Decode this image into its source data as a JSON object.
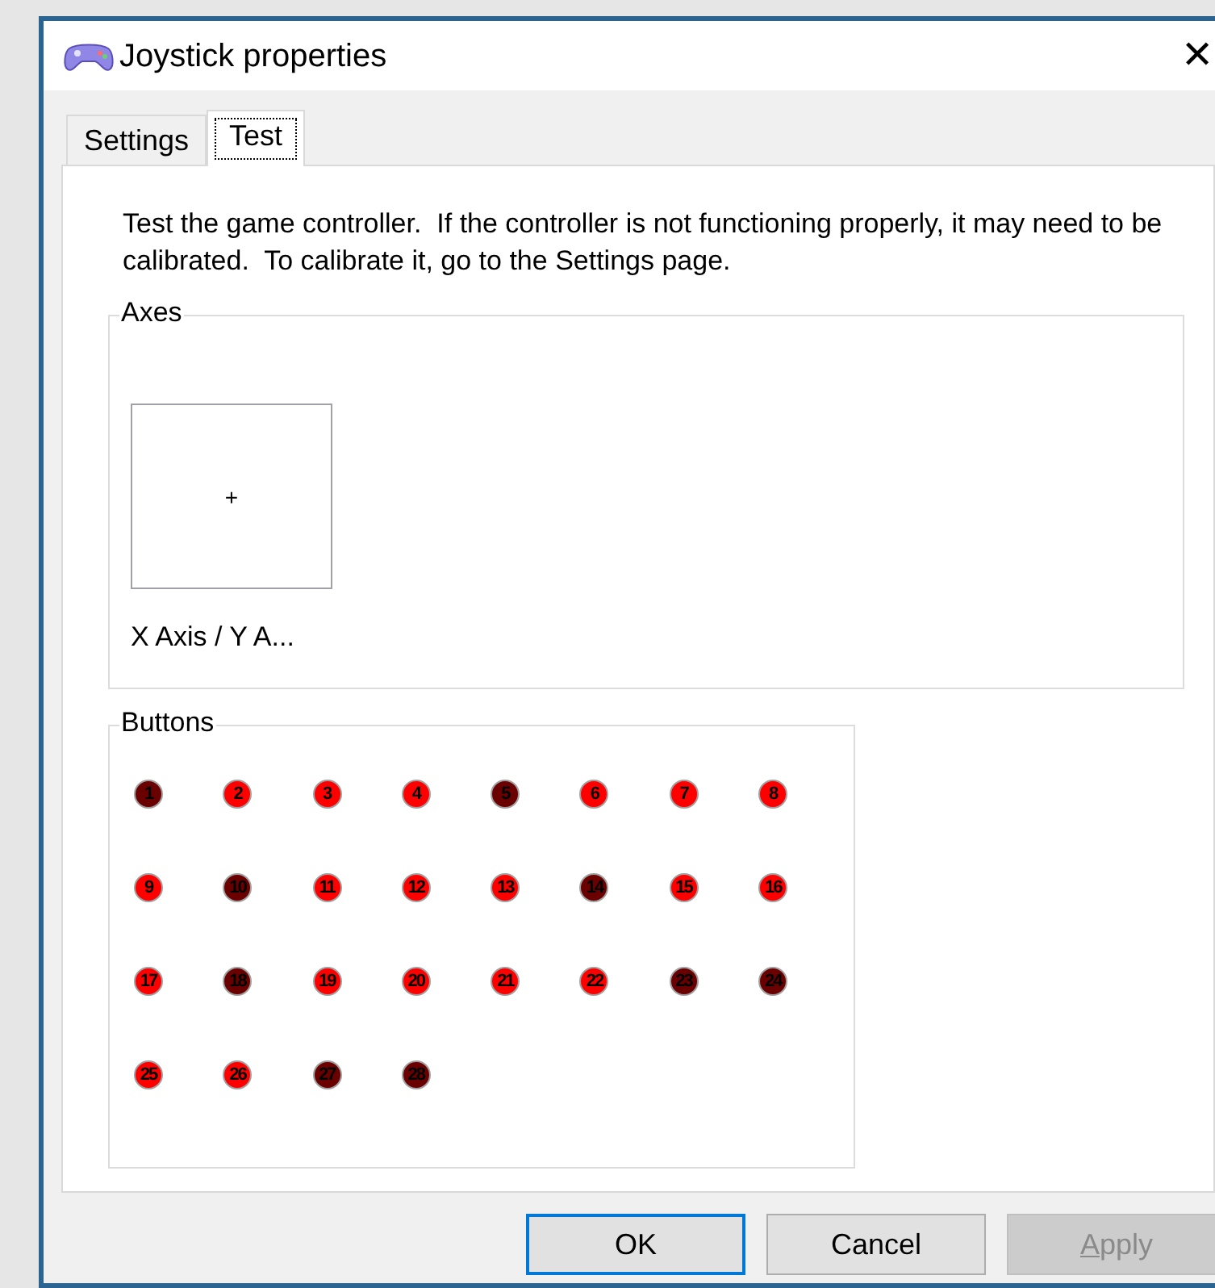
{
  "window": {
    "title": "Joystick properties",
    "close": "✕"
  },
  "tabs": [
    {
      "label": "Settings",
      "selected": false
    },
    {
      "label": "Test",
      "selected": true
    }
  ],
  "description": "Test the game controller.  If the controller is not functioning properly, it may need to be calibrated.  To calibrate it, go to the Settings page.",
  "axes": {
    "title": "Axes",
    "crosshair": "+",
    "label": "X Axis / Y A..."
  },
  "buttons_group": {
    "title": "Buttons",
    "buttons": [
      {
        "label": "1",
        "pressed": true
      },
      {
        "label": "2",
        "pressed": false
      },
      {
        "label": "3",
        "pressed": false
      },
      {
        "label": "4",
        "pressed": false
      },
      {
        "label": "5",
        "pressed": true
      },
      {
        "label": "6",
        "pressed": false
      },
      {
        "label": "7",
        "pressed": false
      },
      {
        "label": "8",
        "pressed": false
      },
      {
        "label": "9",
        "pressed": false
      },
      {
        "label": "10",
        "pressed": true
      },
      {
        "label": "11",
        "pressed": false
      },
      {
        "label": "12",
        "pressed": false
      },
      {
        "label": "13",
        "pressed": false
      },
      {
        "label": "14",
        "pressed": true
      },
      {
        "label": "15",
        "pressed": false
      },
      {
        "label": "16",
        "pressed": false
      },
      {
        "label": "17",
        "pressed": false
      },
      {
        "label": "18",
        "pressed": true
      },
      {
        "label": "19",
        "pressed": false
      },
      {
        "label": "20",
        "pressed": false
      },
      {
        "label": "21",
        "pressed": false
      },
      {
        "label": "22",
        "pressed": false
      },
      {
        "label": "23",
        "pressed": true
      },
      {
        "label": "24",
        "pressed": true
      },
      {
        "label": "25",
        "pressed": false
      },
      {
        "label": "26",
        "pressed": false
      },
      {
        "label": "27",
        "pressed": true
      },
      {
        "label": "28",
        "pressed": true
      }
    ]
  },
  "dialog_buttons": [
    {
      "label": "OK",
      "default": true,
      "disabled": false
    },
    {
      "label": "Cancel",
      "default": false,
      "disabled": false
    },
    {
      "label": "Apply",
      "default": false,
      "disabled": true
    }
  ]
}
